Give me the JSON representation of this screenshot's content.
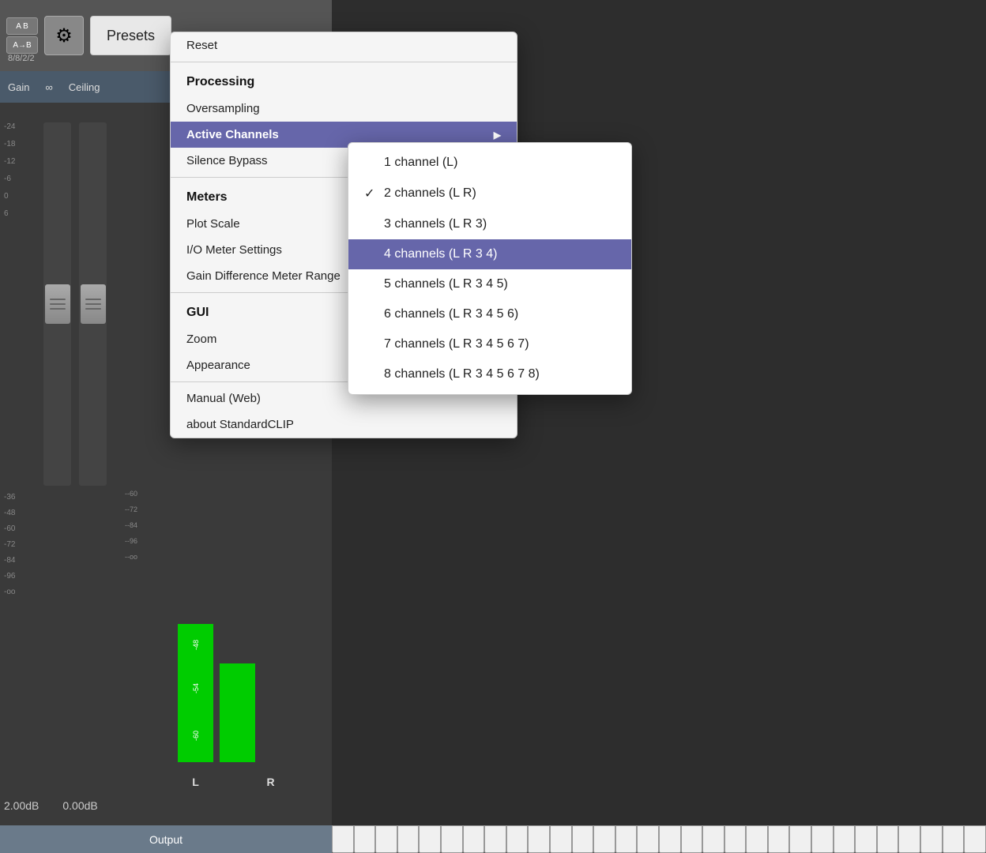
{
  "header": {
    "ab_btn1": "A  B",
    "ab_btn2": "A→B",
    "gear_icon": "⚙",
    "presets_label": "Presets",
    "timestamp": "8/8/2/2"
  },
  "plugin": {
    "gain_label": "Gain",
    "ceiling_label": "Ceiling",
    "gain_value": "2.00dB",
    "ceiling_value": "0.00dB",
    "output_label": "Output",
    "meter_l_label": "L",
    "meter_r_label": "R"
  },
  "scale_values": [
    "-24",
    "-18",
    "-12",
    "-6",
    "0",
    "6",
    "-6",
    "-12",
    "-18",
    "-24",
    "-36",
    "-48",
    "-60",
    "-72",
    "-84",
    "-96",
    "-oo"
  ],
  "right_scale": [
    "--60",
    "--72",
    "--84",
    "--96",
    "--oo"
  ],
  "meter_numbers": [
    "-48",
    "-54",
    "-60"
  ],
  "menu": {
    "reset_label": "Reset",
    "processing_header": "Processing",
    "oversampling_label": "Oversampling",
    "active_channels_label": "Active Channels",
    "silence_bypass_label": "Silence Bypass",
    "meters_header": "Meters",
    "plot_scale_label": "Plot Scale",
    "io_meter_label": "I/O Meter Settings",
    "gain_diff_label": "Gain Difference Meter Range",
    "gui_header": "GUI",
    "zoom_label": "Zoom",
    "appearance_label": "Appearance",
    "manual_label": "Manual (Web)",
    "about_label": "about StandardCLIP"
  },
  "submenu": {
    "items": [
      {
        "label": "1 channel (L)",
        "checked": false,
        "highlighted": false
      },
      {
        "label": "2 channels (L R)",
        "checked": true,
        "highlighted": false
      },
      {
        "label": "3 channels (L R 3)",
        "checked": false,
        "highlighted": false
      },
      {
        "label": "4 channels (L R 3 4)",
        "checked": false,
        "highlighted": true
      },
      {
        "label": "5 channels (L R 3 4 5)",
        "checked": false,
        "highlighted": false
      },
      {
        "label": "6 channels (L R 3 4 5 6)",
        "checked": false,
        "highlighted": false
      },
      {
        "label": "7 channels (L R 3 4 5 6 7)",
        "checked": false,
        "highlighted": false
      },
      {
        "label": "8 channels (L R 3 4 5 6 7 8)",
        "checked": false,
        "highlighted": false
      }
    ]
  },
  "colors": {
    "menu_highlight": "#6666aa",
    "meter_green": "#00cc00",
    "header_bg": "#555555"
  }
}
